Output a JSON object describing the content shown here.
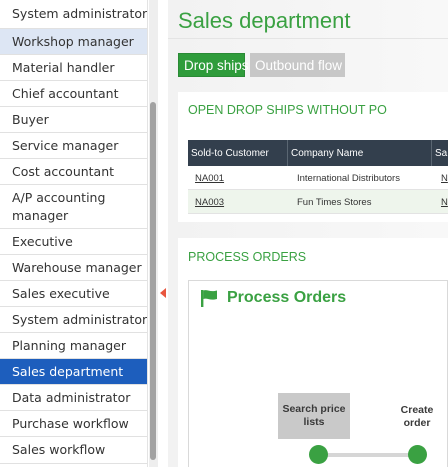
{
  "sidebar": {
    "items": [
      {
        "label": "System administrator"
      },
      {
        "label": "Workshop manager"
      },
      {
        "label": "Material handler"
      },
      {
        "label": "Chief accountant"
      },
      {
        "label": "Buyer"
      },
      {
        "label": "Service manager"
      },
      {
        "label": "Cost accountant"
      },
      {
        "label": "A/P accounting manager"
      },
      {
        "label": "Executive"
      },
      {
        "label": "Warehouse manager"
      },
      {
        "label": "Sales executive"
      },
      {
        "label": "System administrator"
      },
      {
        "label": "Planning manager"
      },
      {
        "label": "Sales department"
      },
      {
        "label": "Data administrator"
      },
      {
        "label": "Purchase workflow"
      },
      {
        "label": "Sales workflow"
      }
    ],
    "selected": "Sales department",
    "hover": "Workshop manager"
  },
  "page": {
    "title": "Sales department"
  },
  "tabs": [
    {
      "label": "Drop ships"
    },
    {
      "label": "Outbound flow"
    }
  ],
  "drop_ships": {
    "section_title": "OPEN DROP SHIPS WITHOUT PO",
    "columns": [
      "Sold-to Customer",
      "Company Name",
      "Sa"
    ],
    "rows": [
      {
        "customer": "NA001",
        "company": "International Distributors",
        "extra": "N"
      },
      {
        "customer": "NA003",
        "company": "Fun Times Stores",
        "extra": "N"
      }
    ]
  },
  "process_orders": {
    "section_title": "PROCESS ORDERS",
    "heading": "Process Orders",
    "steps": [
      {
        "label": "Search price lists"
      },
      {
        "label": "Create order"
      }
    ]
  },
  "colors": {
    "accent_green": "#3aa142",
    "selected_blue": "#1d5ebd",
    "grid_header": "#333f4d"
  }
}
